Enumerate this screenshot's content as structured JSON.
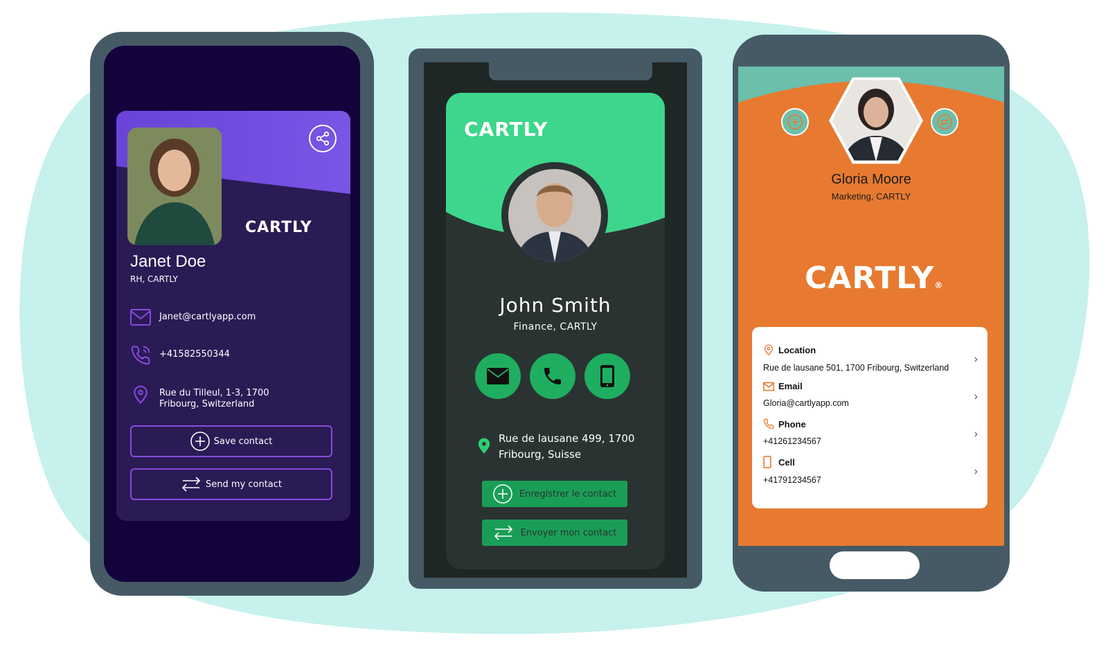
{
  "brand": {
    "logo_text": "CARTLY",
    "registered_mark": "®"
  },
  "colors": {
    "backdrop_blob": "#c6f1ec",
    "phone_frame": "#465a66",
    "purple_accent": "#8a4ae0",
    "green_accent": "#3dd68c",
    "orange_accent": "#e77a30",
    "teal_band": "#6bbfab"
  },
  "card_purple": {
    "name": "Janet Doe",
    "role": "RH, CARTLY",
    "email": "Janet@cartlyapp.com",
    "phone": "+41582550344",
    "address": "Rue du Tilleul, 1-3, 1700 Fribourg, Switzerland",
    "save_label": "Save contact",
    "send_label": "Send my contact",
    "icons": [
      "share-icon",
      "mail-icon",
      "phone-icon",
      "location-pin-icon",
      "plus-circle-icon",
      "swap-arrows-icon"
    ]
  },
  "card_green": {
    "name": "John Smith",
    "role": "Finance, CARTLY",
    "address": "Rue de lausane 499, 1700 Fribourg, Suisse",
    "save_label": "Enregistrer le contact",
    "send_label": "Envoyer mon contact",
    "icons": [
      "mail-icon",
      "phone-icon",
      "mobile-icon",
      "location-pin-icon",
      "plus-circle-icon",
      "swap-arrows-icon"
    ]
  },
  "card_orange": {
    "name": "Gloria Moore",
    "role": "Marketing, CARTLY",
    "items": [
      {
        "label": "Location",
        "value": "Rue de lausane 501, 1700 Fribourg, Switzerland",
        "icon": "location-pin-icon"
      },
      {
        "label": "Email",
        "value": "Gloria@cartlyapp.com",
        "icon": "mail-icon"
      },
      {
        "label": "Phone",
        "value": "+41261234567",
        "icon": "phone-icon"
      },
      {
        "label": "Cell",
        "value": "+41791234567",
        "icon": "mobile-icon"
      }
    ],
    "icons": [
      "plus-circle-icon",
      "swap-arrows-icon",
      "chevron-right-icon"
    ]
  }
}
